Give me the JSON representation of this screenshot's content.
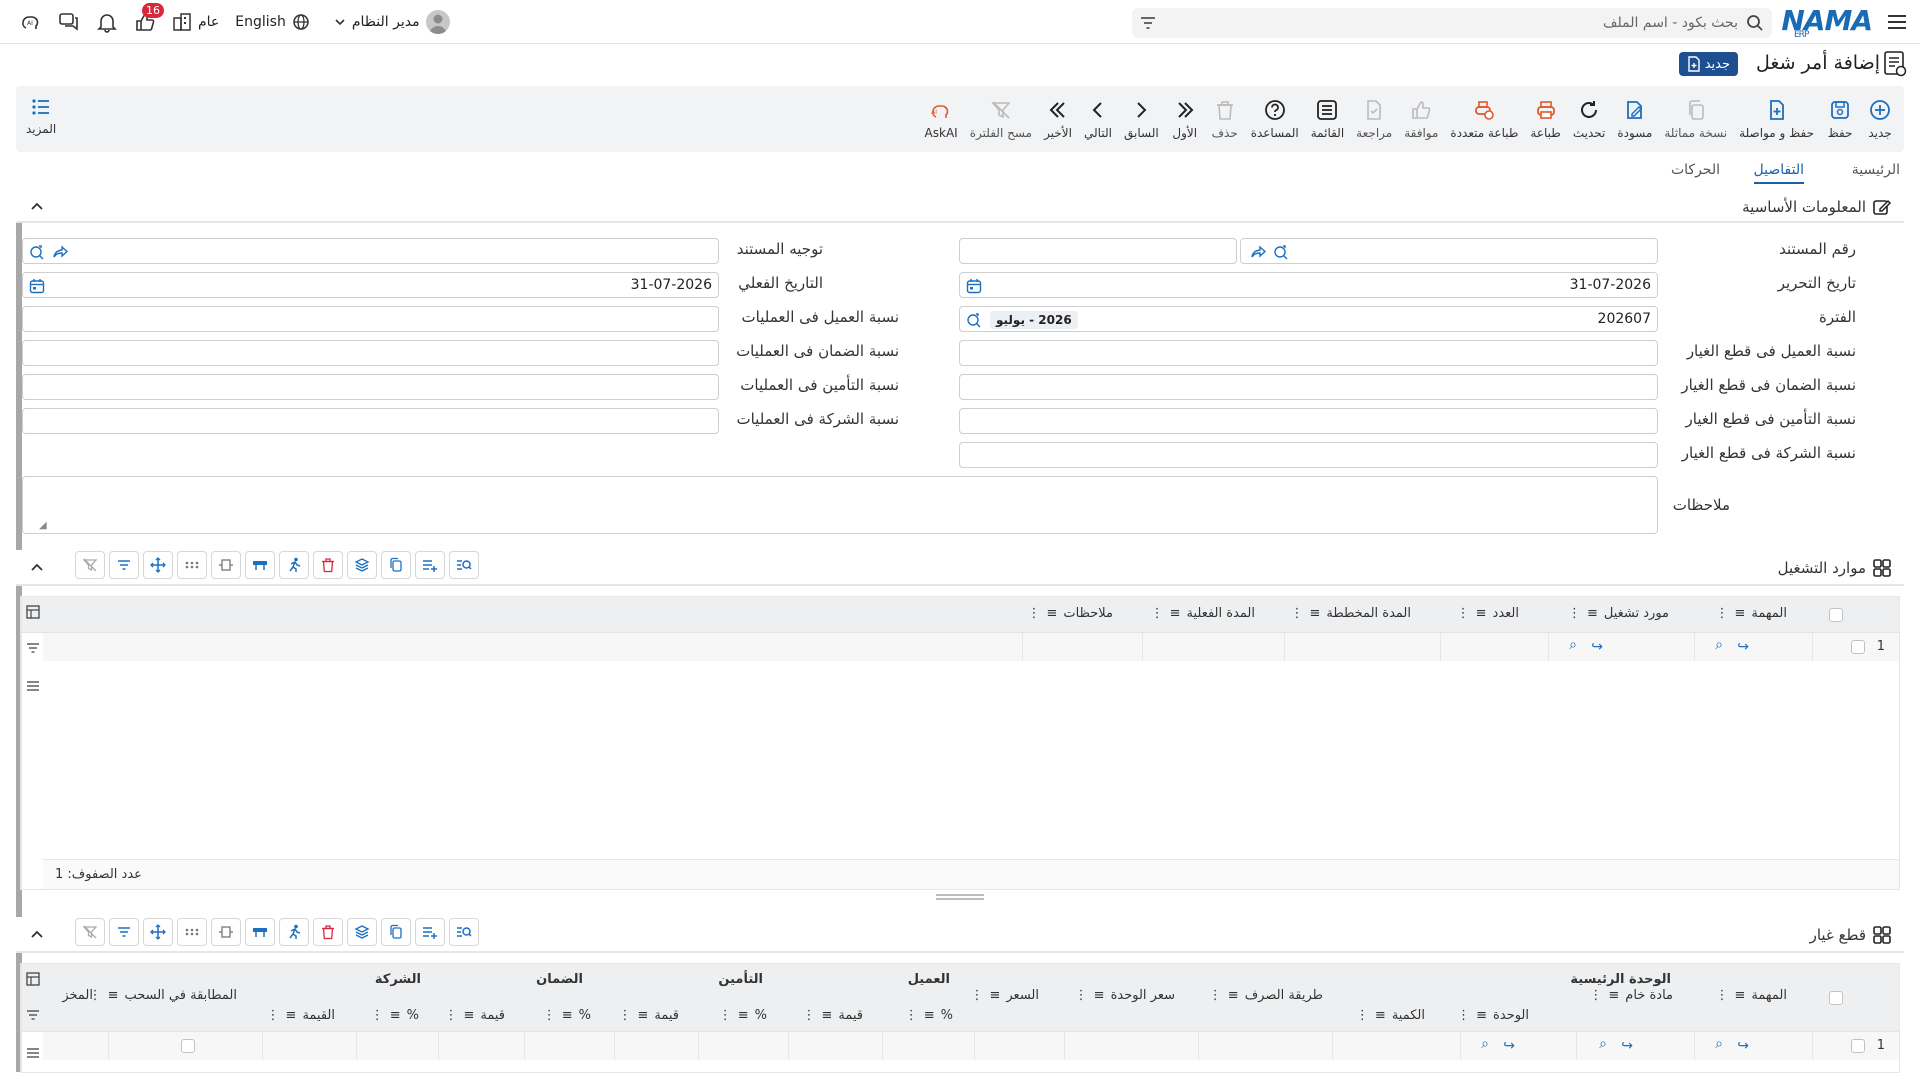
{
  "topbar": {
    "search_placeholder": "بحث بكود - اسم الملف",
    "logo_text": "NAMA",
    "logo_sub": "ERP",
    "user_name": "مدير النظام",
    "language": "English",
    "branch_label": "عام",
    "notification_count": "16"
  },
  "title": {
    "text": "إضافة أمر شغل",
    "new_label": "جديد"
  },
  "toolbar": {
    "new": "جديد",
    "save": "حفظ",
    "save_continue": "حفظ و مواصلة",
    "copy": "نسخة مماثلة",
    "draft": "مسودة",
    "refresh": "تحديث",
    "print": "طباعة",
    "multi_print": "طباعة متعددة",
    "approve": "موافقة",
    "review": "مراجعة",
    "list": "القائمة",
    "help": "المساعدة",
    "delete": "حذف",
    "first": "الأول",
    "prev": "السابق",
    "next": "التالي",
    "last": "الأخير",
    "clear_filter": "مسح الفلترة",
    "askai": "AskAI",
    "more": "المزيد"
  },
  "tabs": {
    "main": "الرئيسية",
    "details": "التفاصيل",
    "movements": "الحركات"
  },
  "basic": {
    "section_title": "المعلومات الأساسية",
    "doc_number_label": "رقم المستند",
    "doc_direction_label": "توجيه المستند",
    "edit_date_label": "تاريخ التحرير",
    "edit_date_value": "31-07-2026",
    "actual_date_label": "التاريخ الفعلي",
    "actual_date_value": "31-07-2026",
    "period_label": "الفترة",
    "period_value": "202607",
    "period_chip": "2026 - يوليو",
    "cust_ops_label": "نسبة العميل فى العمليات",
    "cust_parts_label": "نسبة العميل فى قطع الغيار",
    "warranty_ops_label": "نسبة الضمان فى العمليات",
    "warranty_parts_label": "نسبة الضمان فى قطع الغيار",
    "insurance_ops_label": "نسبة التأمين فى العمليات",
    "insurance_parts_label": "نسبة التأمين فى قطع الغيار",
    "company_ops_label": "نسبة الشركة فى العمليات",
    "company_parts_label": "نسبة الشركة فى قطع الغيار",
    "notes_label": "ملاحظات"
  },
  "resources": {
    "section_title": "موارد التشغيل",
    "columns": [
      "المهمة",
      "مورد تشغيل",
      "العدد",
      "المدة المخططة",
      "المدة الفعلية",
      "ملاحظات"
    ],
    "row_number": "1",
    "row_count_label": "عدد الصفوف: 1"
  },
  "parts": {
    "section_title": "قطع غيار",
    "group_main_unit": "الوحدة الرئيسية",
    "group_customer": "العميل",
    "group_insurance": "التأمين",
    "group_warranty": "الضمان",
    "group_company": "الشركة",
    "col_task": "المهمة",
    "col_material": "مادة خام",
    "col_unit": "الوحدة",
    "col_qty": "الكمية",
    "col_dispense": "طريقة الصرف",
    "col_unit_price": "سعر الوحدة",
    "col_price": "السعر",
    "col_pct": "%",
    "col_value": "قيمة",
    "col_value_company": "القيمة",
    "col_match": "المطابقة في السحب",
    "col_store": "المخز",
    "row_number": "1"
  }
}
